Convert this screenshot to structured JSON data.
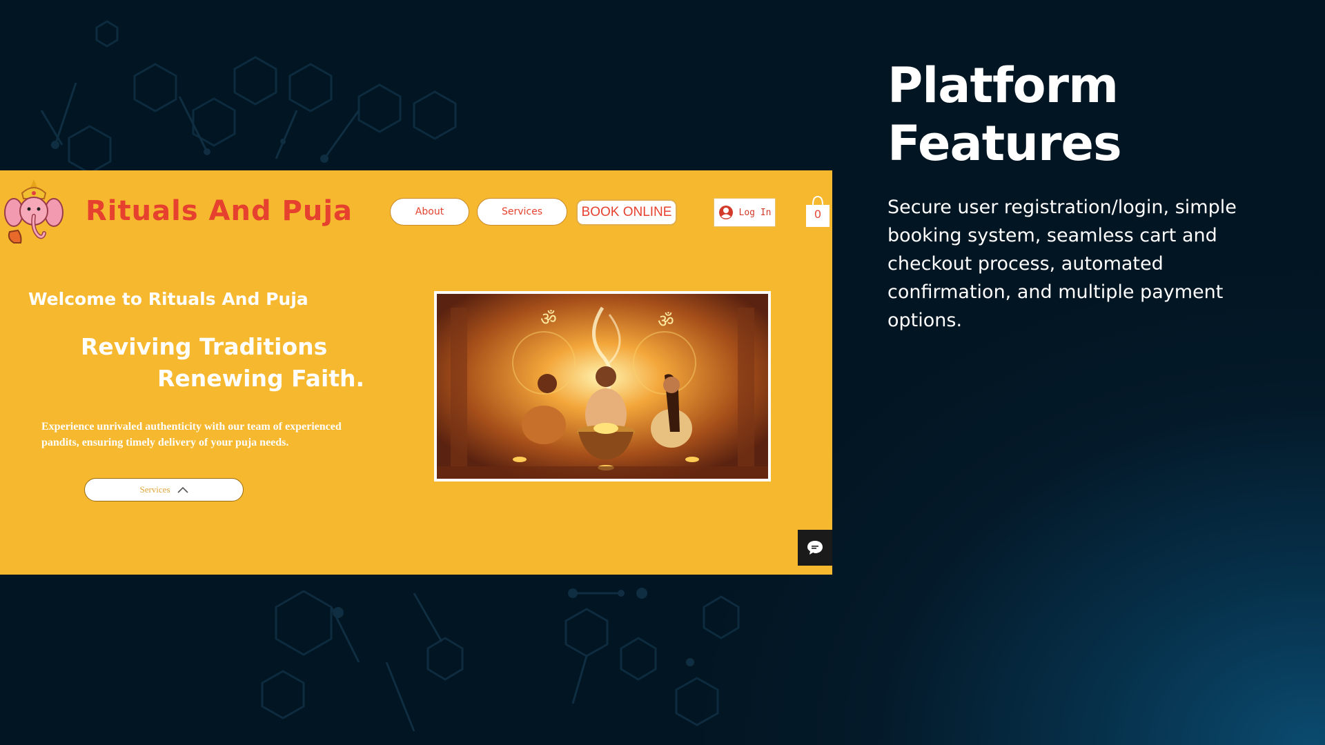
{
  "site": {
    "brand": "Rituals And Puja",
    "nav": {
      "about": "About",
      "services": "Services",
      "book": "BOOK ONLINE",
      "login": "Log In",
      "cart_count": "0"
    },
    "hero": {
      "welcome": "Welcome to Rituals And Puja",
      "tagline_line1": "Reviving Traditions",
      "tagline_line2": "Renewing Faith.",
      "description": "Experience unrivaled authenticity with our team of experienced pandits, ensuring timely delivery of your puja needs.",
      "services_button": "Services"
    }
  },
  "slide": {
    "title": "Platform Features",
    "body": "Secure user registration/login, simple booking system, seamless cart and checkout process, automated confirmation, and multiple payment options."
  },
  "colors": {
    "background": "#021522",
    "site_bg": "#f5b82e",
    "brand_red": "#e6412e",
    "white": "#ffffff"
  },
  "icons": [
    "ganesha-logo-icon",
    "user-avatar-icon",
    "shopping-bag-icon",
    "chevron-up-icon",
    "chat-icon"
  ]
}
